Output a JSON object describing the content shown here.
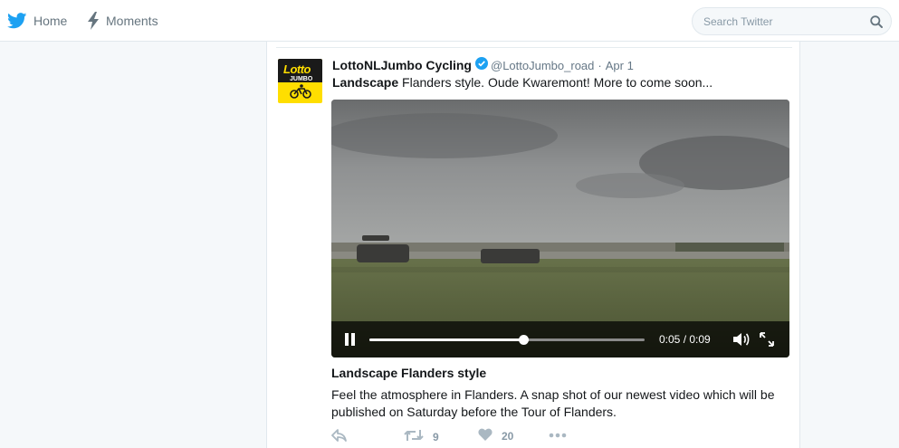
{
  "nav": {
    "home_label": "Home",
    "moments_label": "Moments"
  },
  "search": {
    "placeholder": "Search Twitter"
  },
  "tweet": {
    "fullname": "LottoNLJumbo Cycling",
    "handle": "@LottoJumbo_road",
    "separator": "·",
    "time": "Apr 1",
    "text_bold": "Landscape",
    "text_rest": " Flanders style. Oude Kwaremont! More to come soon...",
    "avatar": {
      "brand_top": "Lotto",
      "brand_bottom": "JUMBO"
    },
    "video": {
      "time_display": "0:05 / 0:09",
      "progress": 0.56
    },
    "card": {
      "title": "Landscape Flanders style",
      "description": "Feel the atmosphere in Flanders. A snap shot of our newest video which will be published on Saturday before the Tour of Flanders."
    },
    "actions": {
      "retweet_count": "9",
      "like_count": "20"
    }
  },
  "colors": {
    "twitter_blue": "#1da1f2",
    "verified_blue": "#1da1f2",
    "brand_yellow": "#ffde00"
  },
  "icons": [
    "twitter-bird-icon",
    "moments-lightning-icon",
    "search-icon",
    "verified-badge-icon",
    "pause-icon",
    "volume-icon",
    "fullscreen-icon",
    "reply-icon",
    "retweet-icon",
    "like-heart-icon",
    "more-icon"
  ]
}
